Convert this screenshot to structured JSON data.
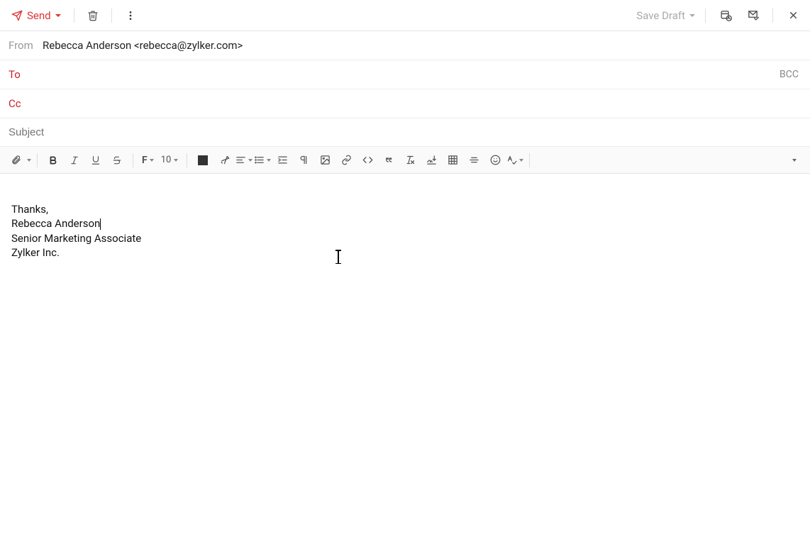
{
  "toolbar": {
    "send_label": "Send",
    "save_draft_label": "Save Draft"
  },
  "fields": {
    "from_label": "From",
    "from_value": "Rebecca Anderson <rebecca@zylker.com>",
    "to_label": "To",
    "cc_label": "Cc",
    "bcc_label": "BCC",
    "subject_placeholder": "Subject"
  },
  "format": {
    "font_size": "10"
  },
  "body": {
    "line1": "Thanks,",
    "line2": "Rebecca Anderson",
    "line3": "Senior Marketing Associate",
    "line4": "Zylker Inc."
  },
  "colors": {
    "accent": "#d33"
  }
}
